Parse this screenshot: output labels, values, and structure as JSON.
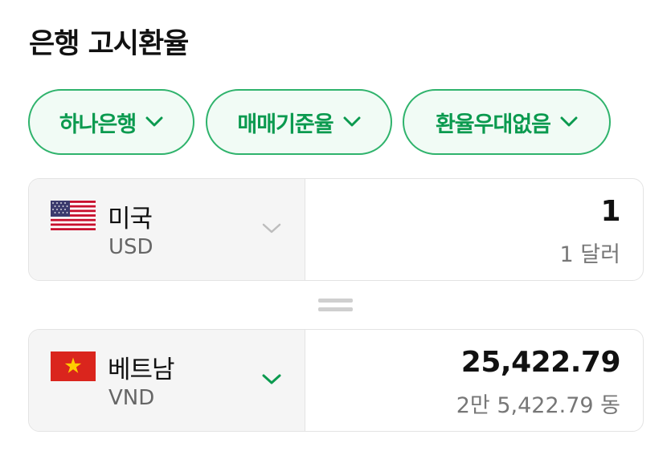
{
  "header": {
    "title": "은행 고시환율"
  },
  "filters": {
    "bank": "하나은행",
    "rate_type": "매매기준율",
    "preferential": "환율우대없음"
  },
  "from_currency": {
    "name": "미국",
    "code": "USD",
    "amount": "1",
    "amount_text": "1 달러",
    "flag_icon": "us-flag-icon"
  },
  "to_currency": {
    "name": "베트남",
    "code": "VND",
    "amount": "25,422.79",
    "amount_text": "2만 5,422.79 동",
    "flag_icon": "vietnam-flag-icon"
  },
  "colors": {
    "accent_green": "#0b9a4f",
    "chip_border": "#2fb36c",
    "chip_bg": "#f1fbf5"
  }
}
